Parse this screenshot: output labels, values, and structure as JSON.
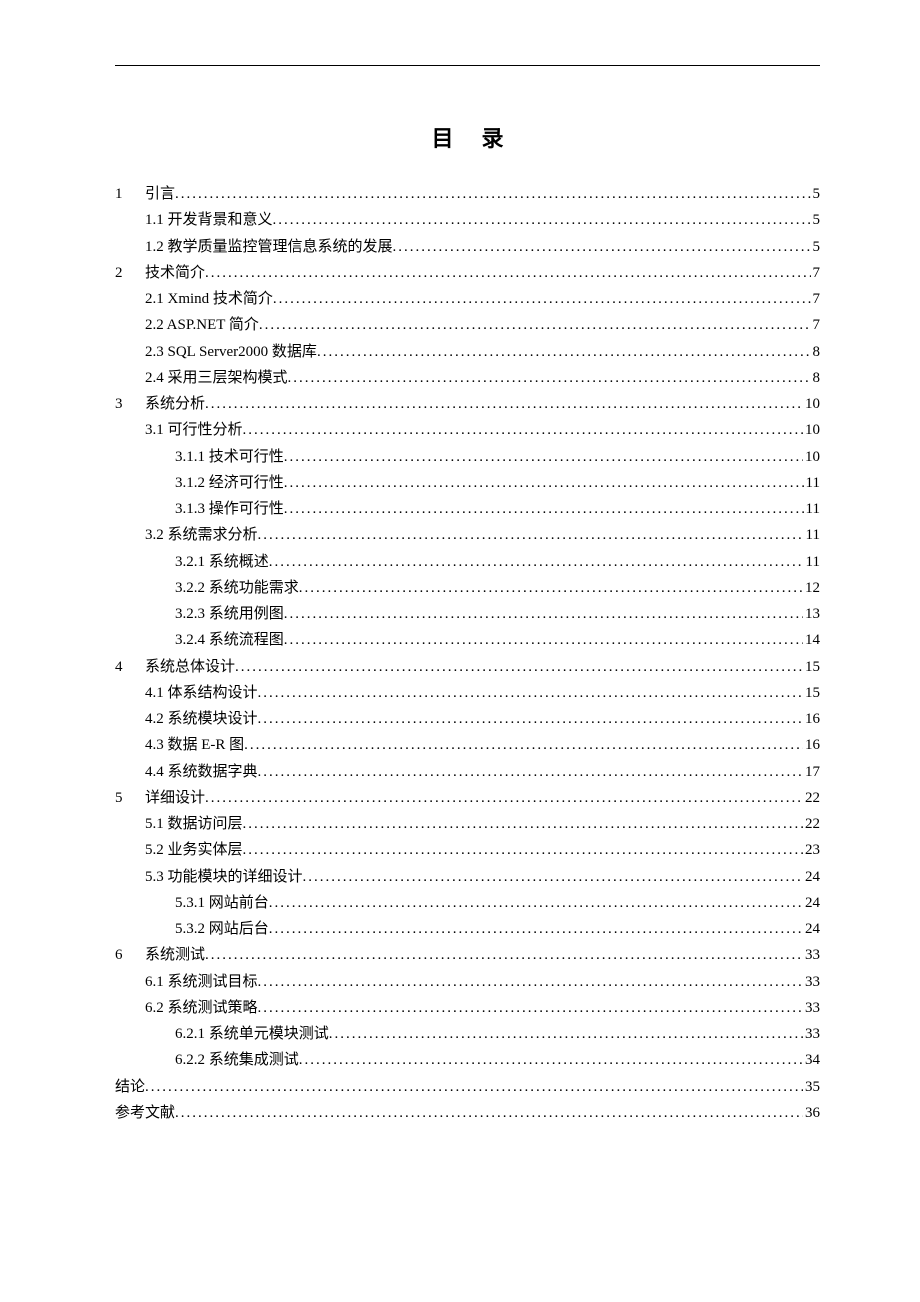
{
  "title": "目录",
  "entries": [
    {
      "num": "1",
      "label": "引言",
      "page": "5",
      "indent": 0
    },
    {
      "num": "",
      "label": "1.1 开发背景和意义",
      "page": "5",
      "indent": 1
    },
    {
      "num": "",
      "label": "1.2 教学质量监控管理信息系统的发展",
      "page": "5",
      "indent": 1
    },
    {
      "num": "2",
      "label": "技术简介",
      "page": "7",
      "indent": 0
    },
    {
      "num": "",
      "label": "2.1 Xmind 技术简介",
      "page": "7",
      "indent": 1
    },
    {
      "num": "",
      "label": "2.2 ASP.NET 简介",
      "page": "7",
      "indent": 1
    },
    {
      "num": "",
      "label": "2.3 SQL Server2000 数据库",
      "page": "8",
      "indent": 1
    },
    {
      "num": "",
      "label": "2.4 采用三层架构模式",
      "page": "8",
      "indent": 1
    },
    {
      "num": "3",
      "label": "系统分析",
      "page": "10",
      "indent": 0
    },
    {
      "num": "",
      "label": "3.1 可行性分析",
      "page": "10",
      "indent": 1
    },
    {
      "num": "",
      "label": "3.1.1 技术可行性",
      "page": "10",
      "indent": 2
    },
    {
      "num": "",
      "label": "3.1.2 经济可行性",
      "page": "11",
      "indent": 2
    },
    {
      "num": "",
      "label": "3.1.3 操作可行性",
      "page": "11",
      "indent": 2
    },
    {
      "num": "",
      "label": "3.2 系统需求分析",
      "page": "11",
      "indent": 1
    },
    {
      "num": "",
      "label": "3.2.1 系统概述",
      "page": "11",
      "indent": 2
    },
    {
      "num": "",
      "label": "3.2.2 系统功能需求",
      "page": "12",
      "indent": 2
    },
    {
      "num": "",
      "label": "3.2.3 系统用例图",
      "page": "13",
      "indent": 2
    },
    {
      "num": "",
      "label": "3.2.4 系统流程图",
      "page": "14",
      "indent": 2
    },
    {
      "num": "4",
      "label": "系统总体设计",
      "page": "15",
      "indent": 0
    },
    {
      "num": "",
      "label": "4.1 体系结构设计",
      "page": "15",
      "indent": 1
    },
    {
      "num": "",
      "label": "4.2 系统模块设计",
      "page": "16",
      "indent": 1
    },
    {
      "num": "",
      "label": "4.3 数据 E-R 图",
      "page": "16",
      "indent": 1
    },
    {
      "num": "",
      "label": "4.4 系统数据字典",
      "page": "17",
      "indent": 1
    },
    {
      "num": "5",
      "label": "详细设计",
      "page": "22",
      "indent": 0
    },
    {
      "num": "",
      "label": "5.1 数据访问层",
      "page": "22",
      "indent": 1
    },
    {
      "num": "",
      "label": "5.2 业务实体层",
      "page": "23",
      "indent": 1
    },
    {
      "num": "",
      "label": "5.3 功能模块的详细设计",
      "page": "24",
      "indent": 1
    },
    {
      "num": "",
      "label": "5.3.1 网站前台",
      "page": "24",
      "indent": 2
    },
    {
      "num": "",
      "label": "5.3.2 网站后台",
      "page": "24",
      "indent": 2
    },
    {
      "num": "6",
      "label": "系统测试",
      "page": "33",
      "indent": 0
    },
    {
      "num": "",
      "label": "6.1 系统测试目标",
      "page": "33",
      "indent": 1
    },
    {
      "num": "",
      "label": "6.2 系统测试策略",
      "page": "33",
      "indent": 1
    },
    {
      "num": "",
      "label": "6.2.1 系统单元模块测试",
      "page": "33",
      "indent": 2
    },
    {
      "num": "",
      "label": "6.2.2 系统集成测试",
      "page": "34",
      "indent": 2
    },
    {
      "num": "",
      "label": "结论",
      "page": "35",
      "indent": 0
    },
    {
      "num": "",
      "label": "参考文献",
      "page": "36",
      "indent": 0
    }
  ]
}
